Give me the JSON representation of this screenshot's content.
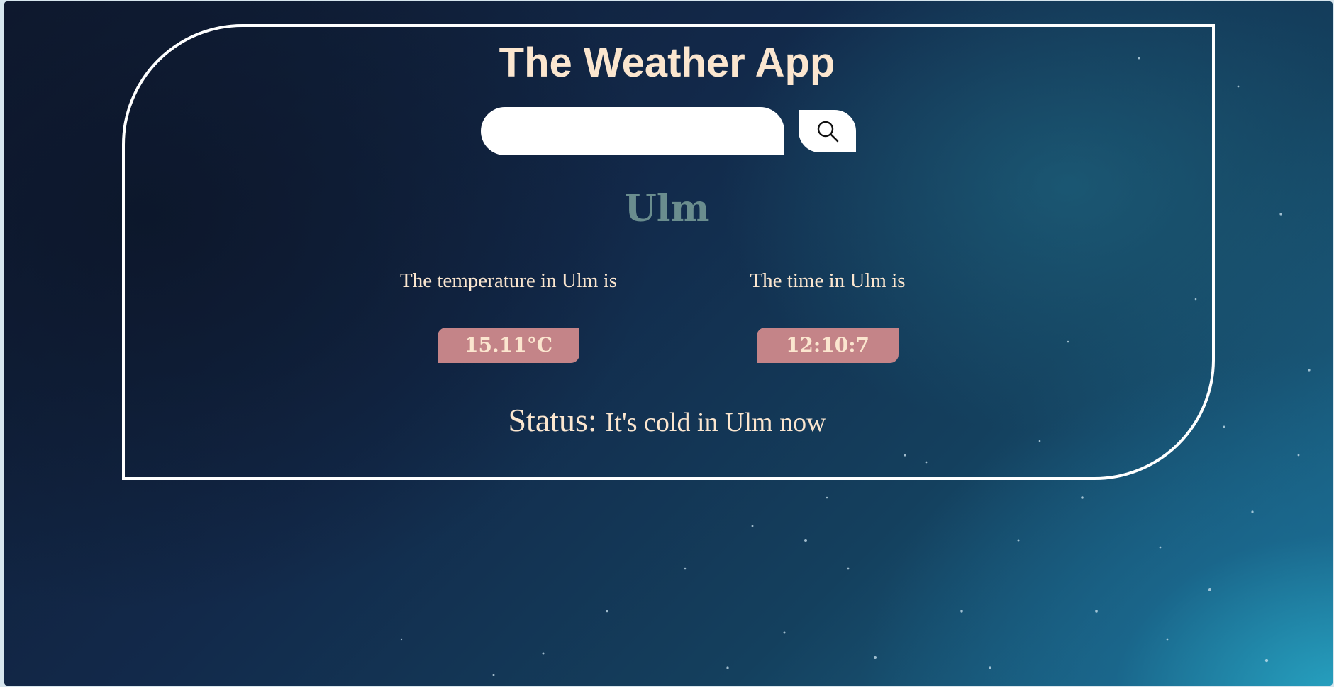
{
  "app": {
    "title": "The Weather App"
  },
  "search": {
    "value": "",
    "placeholder": "",
    "button_icon": "search-icon"
  },
  "weather": {
    "city": "Ulm",
    "temperature_label": "The temperature in Ulm is",
    "temperature_value": "15.11°C",
    "time_label": "The time in Ulm is",
    "time_value": "12:10:7",
    "status_label": "Status:",
    "status_value": "It's cold in Ulm now"
  },
  "colors": {
    "title_text": "#fbe6cf",
    "city_text": "#6a8d8e",
    "pill_background": "#c48488",
    "card_border": "#ffffff",
    "background_dark": "#0f1a30",
    "background_light": "#1d6f92"
  }
}
